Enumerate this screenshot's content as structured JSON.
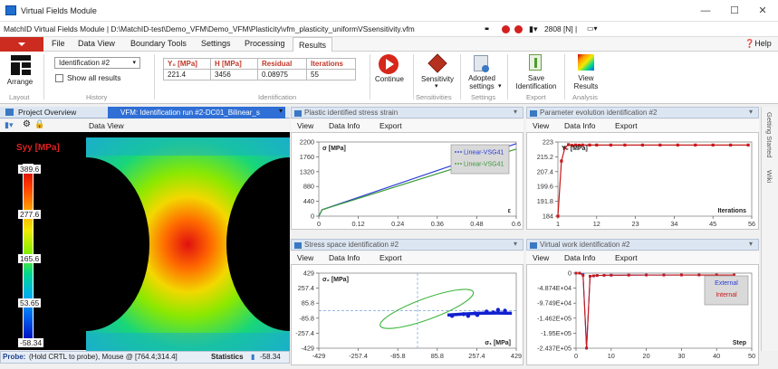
{
  "window": {
    "title": "Virtual Fields Module"
  },
  "pathbar": {
    "path": "MatchID Virtual Fields Module | D:\\MatchID-test\\Demo_VFM\\Demo_VFM\\Plasticity\\vfm_plasticity_uniformVSsensitivity.vfm",
    "memory": "2808 [N] |"
  },
  "menu": {
    "items": [
      "File",
      "Data View",
      "Boundary Tools",
      "Settings",
      "Processing",
      "Results"
    ],
    "active": "Results",
    "help": "Help"
  },
  "ribbon": {
    "arrange": "Arrange",
    "layout_group": "Layout",
    "history_select": "Identification #2",
    "show_all": "Show all results",
    "history_group": "History",
    "table_headers": [
      "Y₀ [MPa]",
      "H [MPa]",
      "Residual",
      "Iterations"
    ],
    "table_values": [
      "221.4",
      "3456",
      "0.08975",
      "55"
    ],
    "identification_group": "Identification",
    "continue": "Continue",
    "sensitivity": "Sensitivity",
    "sensitivities_group": "Sensitivities",
    "adopted_settings": "Adopted settings",
    "settings_group": "Settings",
    "save_identification": "Save Identification",
    "export_group": "Export",
    "view_results": "View Results",
    "analysis_group": "Analysis"
  },
  "left_panel": {
    "tab1": "Project Overview",
    "tab2": "VFM: Identification run #2-DC01_Bilinear_s",
    "toolbar_label": "Data View",
    "field_label": "Syy [MPa]",
    "colorbar_ticks": [
      "389.6",
      "277.6",
      "165.6",
      "53.65",
      "-58.34"
    ],
    "colorbar_colors": [
      "#c80000",
      "#ff3a00",
      "#ff9a00",
      "#f2ea00",
      "#8cf000",
      "#00d890",
      "#00b0f0",
      "#0060f0",
      "#0010c0"
    ]
  },
  "status": {
    "probe_label": "Probe:",
    "probe_text": "(Hold CRTL to probe), Mouse @ [764.4;314.4]",
    "statistics": "Statistics",
    "stat_value": "-58.34"
  },
  "submenu": {
    "view": "View",
    "data_info": "Data Info",
    "export": "Export"
  },
  "panels": {
    "stress_strain": {
      "title": "Plastic identified stress strain"
    },
    "param_evolution": {
      "title": "Parameter evolution identification #2"
    },
    "stress_space": {
      "title": "Stress space identification #2"
    },
    "virtual_work": {
      "title": "Virtual work identification #2"
    }
  },
  "sidebar": {
    "getting_started": "Getting Started",
    "wiki": "Wiki"
  },
  "chart_data": [
    {
      "type": "line",
      "title": "Plastic identified stress strain",
      "ylabel": "σ [MPa]",
      "xlabel": "ε",
      "xlim": [
        0,
        0.6
      ],
      "ylim": [
        0,
        2200
      ],
      "x_ticks": [
        "0",
        "0.12",
        "0.24",
        "0.36",
        "0.48",
        "0.6"
      ],
      "y_ticks": [
        "2200",
        "1760",
        "1320",
        "880",
        "440",
        "0"
      ],
      "series": [
        {
          "name": "Linear-VSG41",
          "color": "#2b3cd8",
          "x": [
            0,
            0.01,
            0.6
          ],
          "y": [
            0,
            190,
            2150
          ]
        },
        {
          "name": "Linear-VSG41",
          "color": "#3a9a3a",
          "x": [
            0,
            0.01,
            0.6
          ],
          "y": [
            0,
            190,
            1990
          ]
        }
      ],
      "legend": "top-right"
    },
    {
      "type": "line",
      "title": "Parameter evolution identification #2",
      "ylabel": "Y₀ [MPa]",
      "xlabel": "Iterations",
      "xlim": [
        1,
        56
      ],
      "ylim": [
        184,
        223
      ],
      "x_ticks": [
        "1",
        "12",
        "23",
        "34",
        "45",
        "56"
      ],
      "y_ticks": [
        "223",
        "215.2",
        "207.4",
        "199.6",
        "191.8",
        "184"
      ],
      "series": [
        {
          "name": "Y0",
          "color": "#c81818",
          "x": [
            1,
            2,
            3,
            4,
            5,
            6,
            7,
            8,
            10,
            12,
            16,
            20,
            25,
            30,
            35,
            40,
            45,
            50,
            55
          ],
          "y": [
            184,
            213,
            220,
            221.6,
            221.2,
            221.4,
            221.3,
            221.4,
            221.4,
            221.4,
            221.4,
            221.4,
            221.4,
            221.4,
            221.4,
            221.4,
            221.4,
            221.4,
            221.4
          ]
        }
      ]
    },
    {
      "type": "scatter",
      "title": "Stress space identification #2",
      "ylabel": "σ₂ [MPa]",
      "xlabel": "σ₁ [MPa]",
      "xlim": [
        -429,
        429
      ],
      "ylim": [
        -429,
        429
      ],
      "x_ticks": [
        "-429",
        "-257.4",
        "-85.8",
        "85.8",
        "257.4",
        "429"
      ],
      "y_ticks": [
        "429",
        "257.4",
        "85.8",
        "-85.8",
        "-257.4",
        "-429"
      ],
      "series": [
        {
          "name": "yield-surface",
          "color": "#3cb43c",
          "type": "ellipse",
          "cx": 40,
          "cy": 20,
          "rx": 215,
          "ry": 120,
          "angle": 20
        },
        {
          "name": "points",
          "color": "#1020d0",
          "x": [
            150,
            200,
            250,
            300,
            350,
            260,
            220,
            300,
            330,
            380
          ],
          "y": [
            -60,
            -40,
            -30,
            -20,
            10,
            -50,
            -60,
            -10,
            -20,
            0
          ]
        }
      ]
    },
    {
      "type": "line",
      "title": "Virtual work identification #2",
      "xlabel": "Step",
      "xlim": [
        0,
        50
      ],
      "ylim": [
        -24370,
        0
      ],
      "x_ticks": [
        "0",
        "10",
        "20",
        "30",
        "40",
        "50"
      ],
      "y_ticks": [
        "0",
        "-4.874E+04",
        "-9.749E+04",
        "-1.462E+05",
        "-1.95E+05",
        "-2.437E+05"
      ],
      "series": [
        {
          "name": "External",
          "color": "#2b3cd8",
          "x": [
            0,
            1,
            2,
            3,
            4,
            5,
            6,
            8,
            10,
            15,
            20,
            25,
            30,
            35,
            40,
            45
          ],
          "y": [
            0,
            0,
            -20,
            -243700,
            -40,
            -38,
            -32,
            -30,
            -28,
            -27,
            -26,
            -26,
            -25,
            -25,
            -25,
            -25
          ]
        },
        {
          "name": "Internal",
          "color": "#c81818",
          "x": [
            0,
            1,
            2,
            3,
            4,
            5,
            6,
            8,
            10,
            15,
            20,
            25,
            30,
            35,
            40,
            45
          ],
          "y": [
            0,
            0,
            -30,
            -243000,
            -42,
            -36,
            -31,
            -29,
            -28,
            -27,
            -26,
            -26,
            -25,
            -25,
            -25,
            -25
          ]
        }
      ],
      "legend": "top-right"
    }
  ]
}
